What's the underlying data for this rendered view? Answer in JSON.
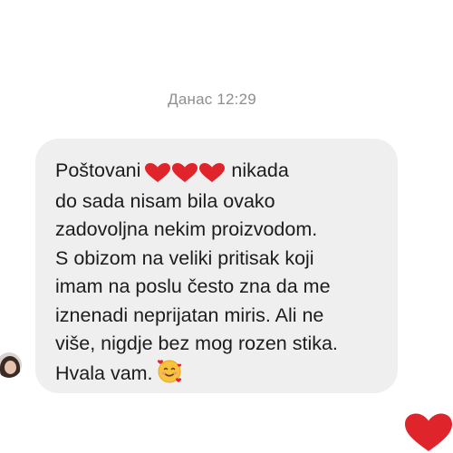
{
  "chat": {
    "timestamp": "Данас 12:29",
    "message": {
      "greeting": "Poštovani",
      "greeting_emoji": "red-hearts-icon",
      "line1_tail": "nikada",
      "lines": [
        "do sada nisam bila ovako",
        "zadovoljna nekim proizvodom.",
        "S obizom na veliki pritisak koji",
        "imam na poslu često zna da me",
        "iznenadi neprijatan miris. Ali ne",
        "više, nigdje bez mog rozen stika."
      ],
      "closing": "Hvala vam.",
      "closing_emoji": "smiling-face-with-hearts-icon"
    },
    "reaction_icon": "red-heart-icon"
  },
  "colors": {
    "bubble": "#efefef",
    "heart": "#e0242c",
    "timestamp": "#8e8e93"
  }
}
